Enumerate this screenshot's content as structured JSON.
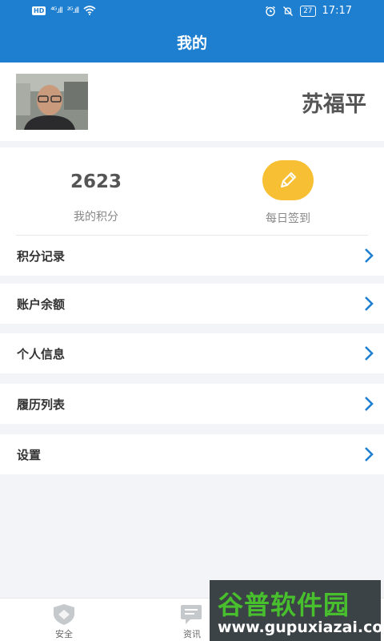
{
  "status_bar": {
    "hd": "HD",
    "signal_1": "⁴ᴳ.ıll",
    "signal_2": "²ᴳ.ıll",
    "battery": "27",
    "time": "17:17"
  },
  "nav": {
    "title": "我的"
  },
  "profile": {
    "name": "苏福平"
  },
  "stats": {
    "points_value": "2623",
    "points_label": "我的积分",
    "sign_label": "每日签到"
  },
  "menu": [
    {
      "label": "积分记录"
    },
    {
      "label": "账户余额"
    },
    {
      "label": "个人信息"
    },
    {
      "label": "履历列表"
    },
    {
      "label": "设置"
    }
  ],
  "tabs": [
    {
      "label": "安全",
      "icon": "shield-icon"
    },
    {
      "label": "资讯",
      "icon": "chat-icon"
    }
  ],
  "watermark": {
    "title": "谷普软件园",
    "url": "www.gupuxiazai.com"
  },
  "colors": {
    "primary": "#1e7fd0",
    "accent": "#f7c034",
    "chevron": "#1e7fd0"
  }
}
